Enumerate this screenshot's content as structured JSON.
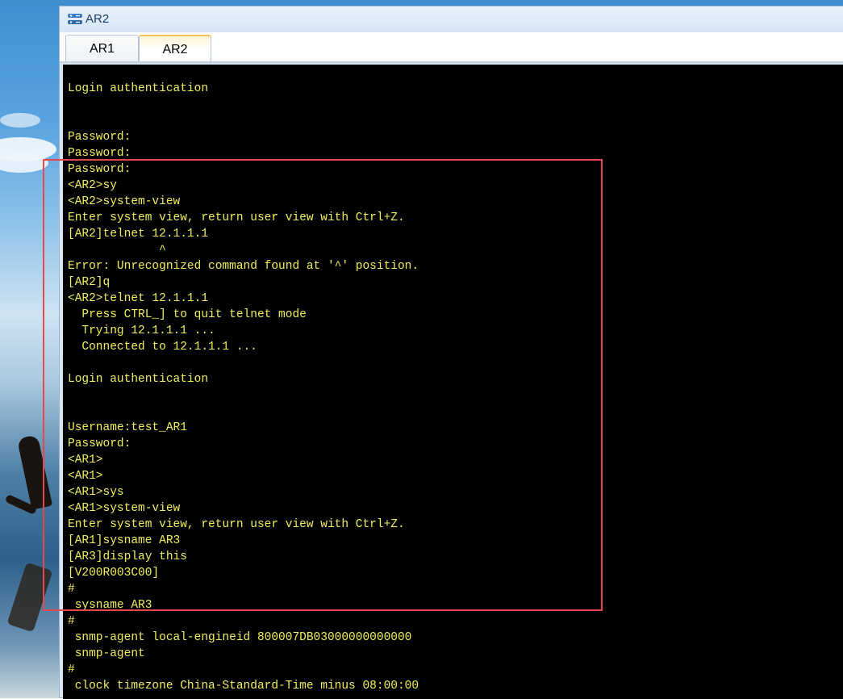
{
  "window": {
    "title": "AR2",
    "icon": "router-icon"
  },
  "tabs": [
    {
      "label": "AR1",
      "active": false
    },
    {
      "label": "AR2",
      "active": true
    }
  ],
  "colors": {
    "terminal_background": "#000000",
    "terminal_text": "#f2ef5a",
    "highlight_border": "#e5484d",
    "active_tab_accent": "#f3c35a"
  },
  "terminal": {
    "lines": [
      "Login authentication",
      "",
      "",
      "Password:",
      "Password:",
      "Password:",
      "<AR2>sy",
      "<AR2>system-view",
      "Enter system view, return user view with Ctrl+Z.",
      "[AR2]telnet 12.1.1.1",
      "             ^",
      "Error: Unrecognized command found at '^' position.",
      "[AR2]q",
      "<AR2>telnet 12.1.1.1",
      "  Press CTRL_] to quit telnet mode",
      "  Trying 12.1.1.1 ...",
      "  Connected to 12.1.1.1 ...",
      "",
      "Login authentication",
      "",
      "",
      "Username:test_AR1",
      "Password:",
      "<AR1>",
      "<AR1>",
      "<AR1>sys",
      "<AR1>system-view",
      "Enter system view, return user view with Ctrl+Z.",
      "[AR1]sysname AR3",
      "[AR3]display this",
      "[V200R003C00]",
      "#",
      " sysname AR3",
      "#",
      " snmp-agent local-engineid 800007DB03000000000000",
      " snmp-agent",
      "#",
      " clock timezone China-Standard-Time minus 08:00:00"
    ]
  }
}
